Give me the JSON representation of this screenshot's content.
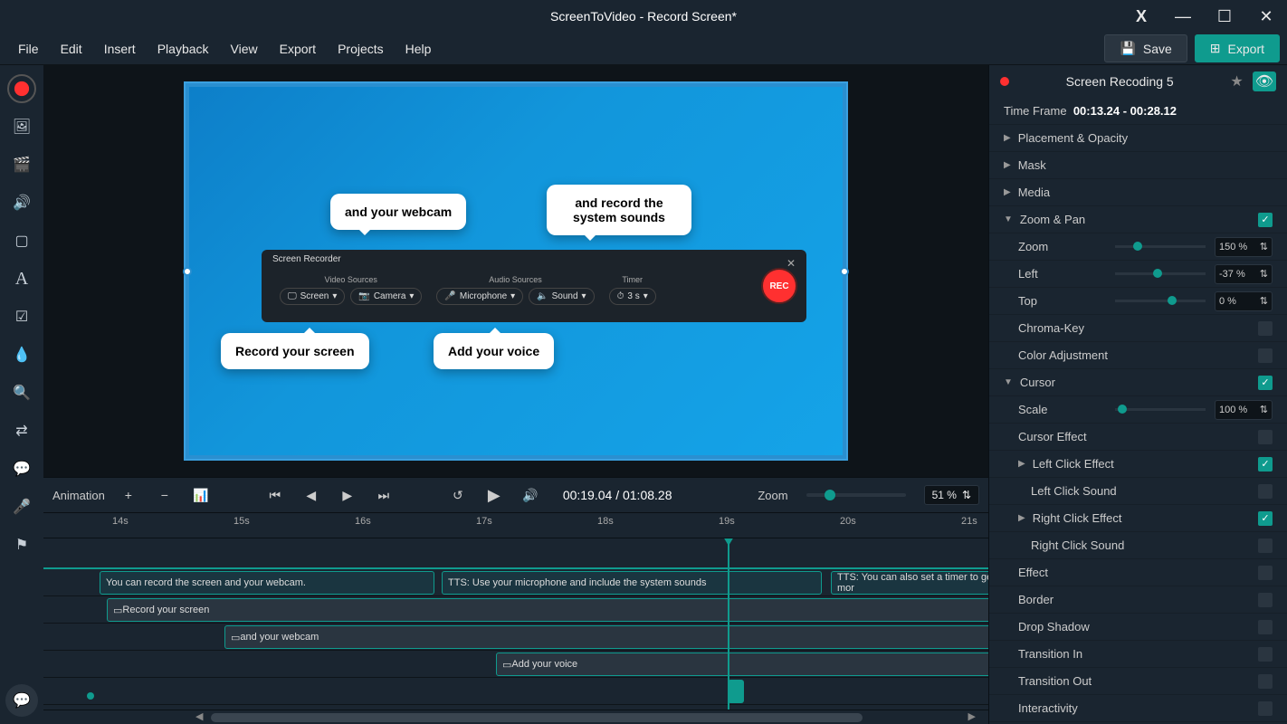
{
  "title": "ScreenToVideo - Record Screen*",
  "menu": [
    "File",
    "Edit",
    "Insert",
    "Playback",
    "View",
    "Export",
    "Projects",
    "Help"
  ],
  "save_label": "Save",
  "export_label": "Export",
  "canvas": {
    "callouts": {
      "c1": "and your webcam",
      "c2": "and record the system sounds",
      "c3": "Record your screen",
      "c4": "Add your voice"
    },
    "recorder": {
      "title": "Screen Recorder",
      "video_label": "Video Sources",
      "audio_label": "Audio Sources",
      "timer_label": "Timer",
      "screen": "Screen",
      "camera": "Camera",
      "mic": "Microphone",
      "sound": "Sound",
      "timer_val": "3 s",
      "rec": "REC"
    }
  },
  "playback": {
    "animation": "Animation",
    "time": "00:19.04 / 01:08.28",
    "zoom_label": "Zoom",
    "zoom_value": "51 %"
  },
  "timeline": {
    "marks": [
      "14s",
      "15s",
      "16s",
      "17s",
      "18s",
      "19s",
      "20s",
      "21s"
    ],
    "clips": {
      "tts1": "You can record the screen and your webcam.",
      "tts2": "TTS: Use your microphone and include the system sounds",
      "tts3": "TTS: You can also set a timer to get mor",
      "a1": "Record your screen",
      "a2": "and your webcam",
      "a3": "Add your voice"
    }
  },
  "inspector": {
    "title": "Screen Recoding 5",
    "timeframe_label": "Time Frame",
    "timeframe": "00:13.24 - 00:28.12",
    "placement": "Placement & Opacity",
    "mask": "Mask",
    "media": "Media",
    "zoom_pan": "Zoom & Pan",
    "zoom": "Zoom",
    "zoom_val": "150 %",
    "left": "Left",
    "left_val": "-37 %",
    "top": "Top",
    "top_val": "0 %",
    "chroma": "Chroma-Key",
    "color_adj": "Color Adjustment",
    "cursor": "Cursor",
    "scale": "Scale",
    "scale_val": "100 %",
    "cursor_effect": "Cursor Effect",
    "lclick": "Left Click Effect",
    "lclick_sound": "Left Click Sound",
    "rclick": "Right Click Effect",
    "rclick_sound": "Right Click Sound",
    "effect": "Effect",
    "border": "Border",
    "drop_shadow": "Drop Shadow",
    "trans_in": "Transition In",
    "trans_out": "Transition Out",
    "interactivity": "Interactivity"
  }
}
